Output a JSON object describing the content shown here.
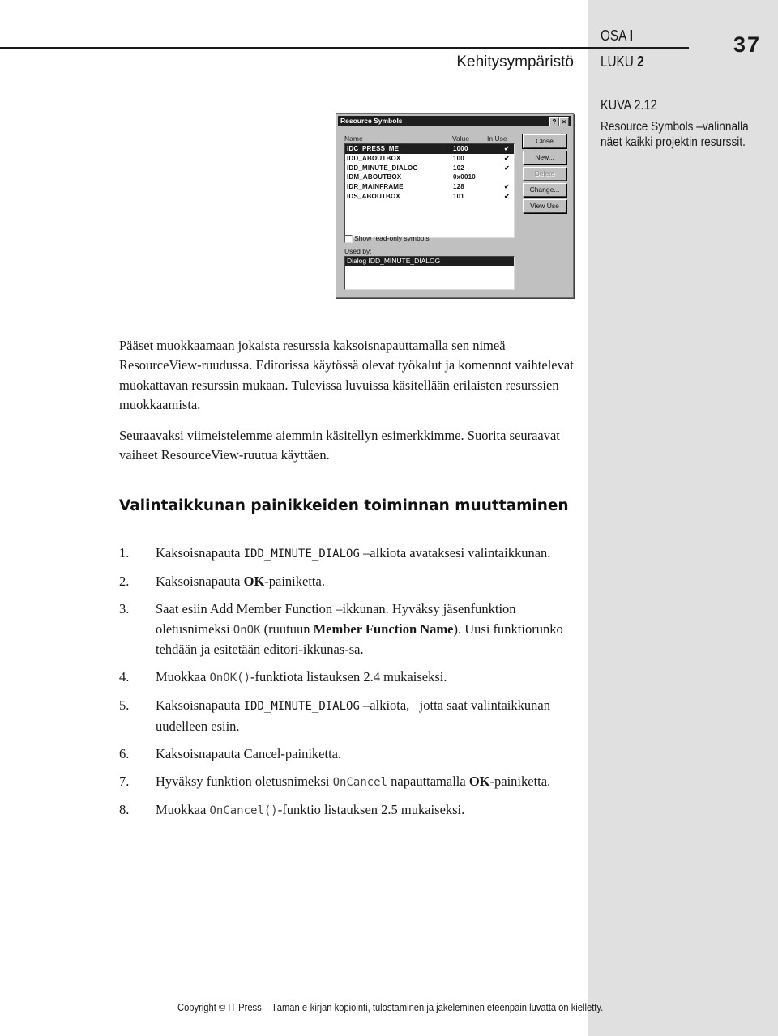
{
  "header": {
    "chapter_title": "Kehitysympäristö",
    "osa_label": "OSA",
    "osa_value": "I",
    "luku_label": "LUKU",
    "luku_value": "2",
    "page_number": "37"
  },
  "figure": {
    "label": "KUVA 2.12",
    "caption": "Resource Symbols –valinnalla näet kaikki projektin resurssit.",
    "dialog": {
      "title": "Resource Symbols",
      "help_button": "?",
      "close_x": "×",
      "columns": {
        "name": "Name",
        "value": "Value",
        "in_use": "In Use"
      },
      "symbols": [
        {
          "name": "IDC_PRESS_ME",
          "value": "1000",
          "in_use": true,
          "selected": true
        },
        {
          "name": "IDD_ABOUTBOX",
          "value": "100",
          "in_use": true,
          "selected": false
        },
        {
          "name": "IDD_MINUTE_DIALOG",
          "value": "102",
          "in_use": true,
          "selected": false
        },
        {
          "name": "IDM_ABOUTBOX",
          "value": "0x0010",
          "in_use": false,
          "selected": false
        },
        {
          "name": "IDR_MAINFRAME",
          "value": "128",
          "in_use": true,
          "selected": false
        },
        {
          "name": "IDS_ABOUTBOX",
          "value": "101",
          "in_use": true,
          "selected": false
        }
      ],
      "check_glyph": "✔",
      "buttons": {
        "close": "Close",
        "new": "New...",
        "delete": "Delete",
        "change": "Change...",
        "view_use": "View Use"
      },
      "show_readonly_label": "Show read-only symbols",
      "show_readonly_checked": false,
      "used_by_label": "Used by:",
      "used_by_items": [
        "Dialog IDD_MINUTE_DIALOG"
      ]
    }
  },
  "body": {
    "paragraph1": "Pääset muokkaamaan jokaista resurssia kaksoisnapauttamalla sen nimeä ResourceView-ruudussa. Editorissa käytössä olevat työkalut ja komennot vaihtelevat muokattavan resurssin mukaan. Tulevissa luvuissa käsitellään erilaisten resurssien muokkaamista.",
    "paragraph2": "Seuraavaksi viimeistelemme aiemmin käsitellyn esimerkkimme. Suorita seuraavat vaiheet ResourceView-ruutua käyttäen.",
    "heading": "Valintaikkunan painikkeiden toiminnan muuttaminen",
    "steps": [
      {
        "num": "1.",
        "t1": "Kaksoisnapauta ",
        "code": "IDD_MINUTE_DIALOG",
        "t2": " –alkiota avataksesi valintaikkunan."
      },
      {
        "num": "2.",
        "t1": "Kaksoisnapauta ",
        "bold": "OK",
        "t2": "-painiketta."
      },
      {
        "num": "3.",
        "t1": "Saat esiin Add Member Function –ikkunan. Hyväksy jäsenfunktion oletusnimeksi ",
        "code": "OnOK",
        "t2": " (ruutuun ",
        "bold": "Member Function Name",
        "t3": "). Uusi funktiorunko tehdään ja esitetään editori-ikkunas-sa."
      },
      {
        "num": "4.",
        "t1": "Muokkaa ",
        "code": "OnOK()",
        "t2": "-funktiota listauksen 2.4 mukaiseksi."
      },
      {
        "num": "5.",
        "t1": "Kaksoisnapauta ",
        "code": "IDD_MINUTE_DIALOG",
        "t2": " –alkiota,   jotta saat valintaikkunan uudelleen esiin."
      },
      {
        "num": "6.",
        "t1": "Kaksoisnapauta ",
        "bold": "Cancel",
        "t2": "-painiketta."
      },
      {
        "num": "7.",
        "t1": "Hyväksy funktion oletusnimeksi ",
        "code": "OnCancel",
        "t2": " napauttamalla ",
        "bold": "OK",
        "t3": "-painiketta."
      },
      {
        "num": "8.",
        "t1": "Muokkaa ",
        "code": "OnCancel()",
        "t2": "-funktio listauksen 2.5 mukaiseksi."
      }
    ]
  },
  "footer": {
    "copyright": "Copyright © IT Press – Tämän e-kirjan kopiointi, tulostaminen ja jakeleminen eteenpäin luvatta on kielletty."
  }
}
